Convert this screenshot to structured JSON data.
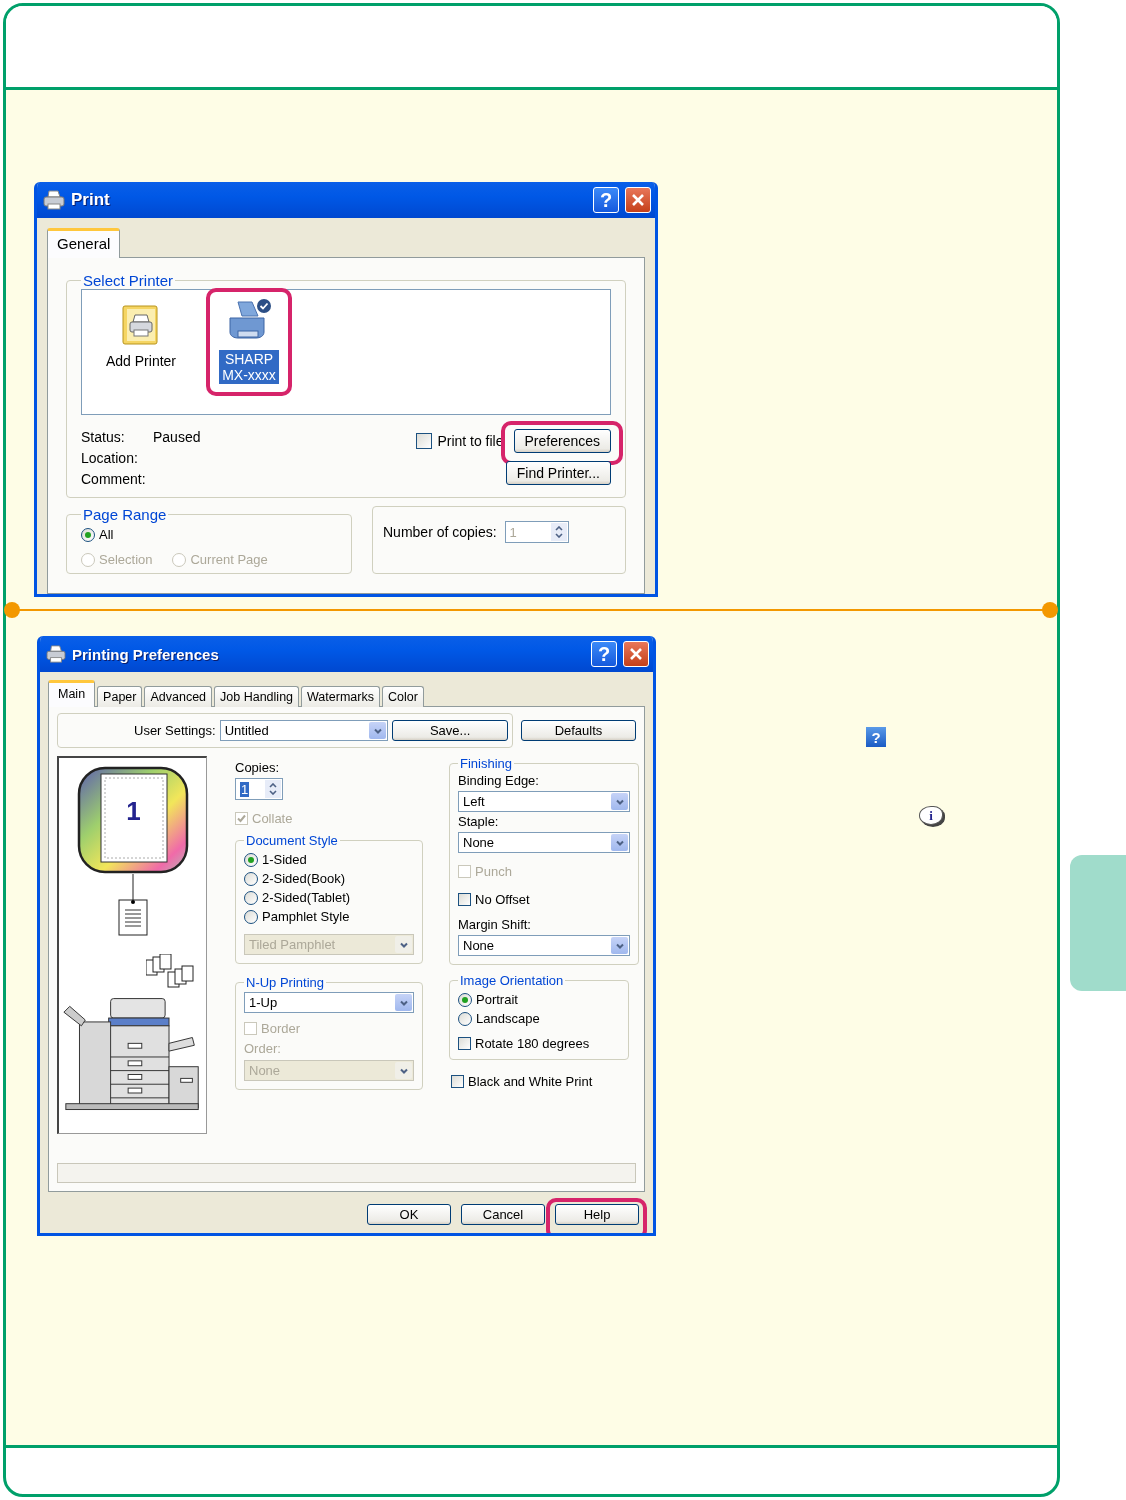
{
  "print_dialog": {
    "title": "Print",
    "help_glyph": "?",
    "tabs": [
      {
        "label": "General",
        "selected": true
      }
    ],
    "select_printer": {
      "legend": "Select Printer",
      "printers": [
        {
          "name": "Add Printer",
          "kind": "add",
          "selected": false,
          "highlighted": false
        },
        {
          "name": "SHARP MX-xxxx",
          "kind": "printer",
          "selected": true,
          "highlighted": true
        }
      ]
    },
    "info": [
      {
        "label": "Status:",
        "value": "Paused"
      },
      {
        "label": "Location:"
      },
      {
        "label": "Comment:"
      }
    ],
    "print_to_file": {
      "label": "Print to file",
      "checked": false
    },
    "buttons": [
      {
        "label": "Preferences",
        "highlighted": true
      },
      {
        "label": "Find Printer...",
        "highlighted": false
      }
    ],
    "page_range": {
      "legend": "Page Range",
      "options": [
        {
          "label": "All",
          "selected": true
        },
        {
          "label": "Selection",
          "selected": false
        },
        {
          "label": "Current Page",
          "selected": false
        }
      ]
    },
    "copies": {
      "label": "Number of copies:",
      "value": "1"
    }
  },
  "preferences_dialog": {
    "title": "Printing Preferences",
    "help_glyph": "?",
    "tabs": [
      {
        "label": "Main",
        "selected": true
      },
      {
        "label": "Paper",
        "selected": false
      },
      {
        "label": "Advanced",
        "selected": false
      },
      {
        "label": "Job Handling",
        "selected": false
      },
      {
        "label": "Watermarks",
        "selected": false
      },
      {
        "label": "Color",
        "selected": false
      }
    ],
    "user_settings": {
      "label": "User Settings:",
      "value": "Untitled"
    },
    "setting_buttons": [
      "Save...",
      "Defaults"
    ],
    "preview": {
      "page_number": "1"
    },
    "copies": {
      "label": "Copies:",
      "value": "1"
    },
    "collate": {
      "label": "Collate",
      "checked": true,
      "disabled": true
    },
    "document_style": {
      "legend": "Document Style",
      "options": [
        {
          "label": "1-Sided",
          "selected": true
        },
        {
          "label": "2-Sided(Book)",
          "selected": false
        },
        {
          "label": "2-Sided(Tablet)",
          "selected": false
        },
        {
          "label": "Pamphlet Style",
          "selected": false
        }
      ],
      "pamphlet": {
        "value": "Tiled Pamphlet",
        "disabled": true
      }
    },
    "n_up": {
      "legend": "N-Up Printing",
      "value": "1-Up",
      "border": {
        "label": "Border",
        "checked": false,
        "disabled": true
      },
      "order": {
        "label": "Order:",
        "value": "None",
        "disabled": true
      }
    },
    "finishing": {
      "legend": "Finishing",
      "fields": [
        {
          "label": "Binding Edge:",
          "value": "Left"
        },
        {
          "label": "Staple:",
          "value": "None"
        }
      ],
      "checks": [
        {
          "label": "Punch",
          "checked": false,
          "disabled": true
        },
        {
          "label": "No Offset",
          "checked": false,
          "disabled": false
        }
      ],
      "margin_shift": {
        "label": "Margin Shift:",
        "value": "None"
      }
    },
    "image_orientation": {
      "legend": "Image Orientation",
      "options": [
        {
          "label": "Portrait",
          "selected": true
        },
        {
          "label": "Landscape",
          "selected": false
        }
      ],
      "rotate": {
        "label": "Rotate 180 degrees",
        "checked": false,
        "disabled": false
      }
    },
    "black_and_white": {
      "label": "Black and White Print",
      "checked": false,
      "disabled": false
    },
    "buttons": [
      {
        "label": "OK",
        "highlighted": false
      },
      {
        "label": "Cancel",
        "highlighted": false
      },
      {
        "label": "Help",
        "highlighted": true
      }
    ]
  },
  "side_icons": [
    {
      "kind": "help",
      "glyph": "?"
    },
    {
      "kind": "info",
      "glyph": "i"
    }
  ]
}
